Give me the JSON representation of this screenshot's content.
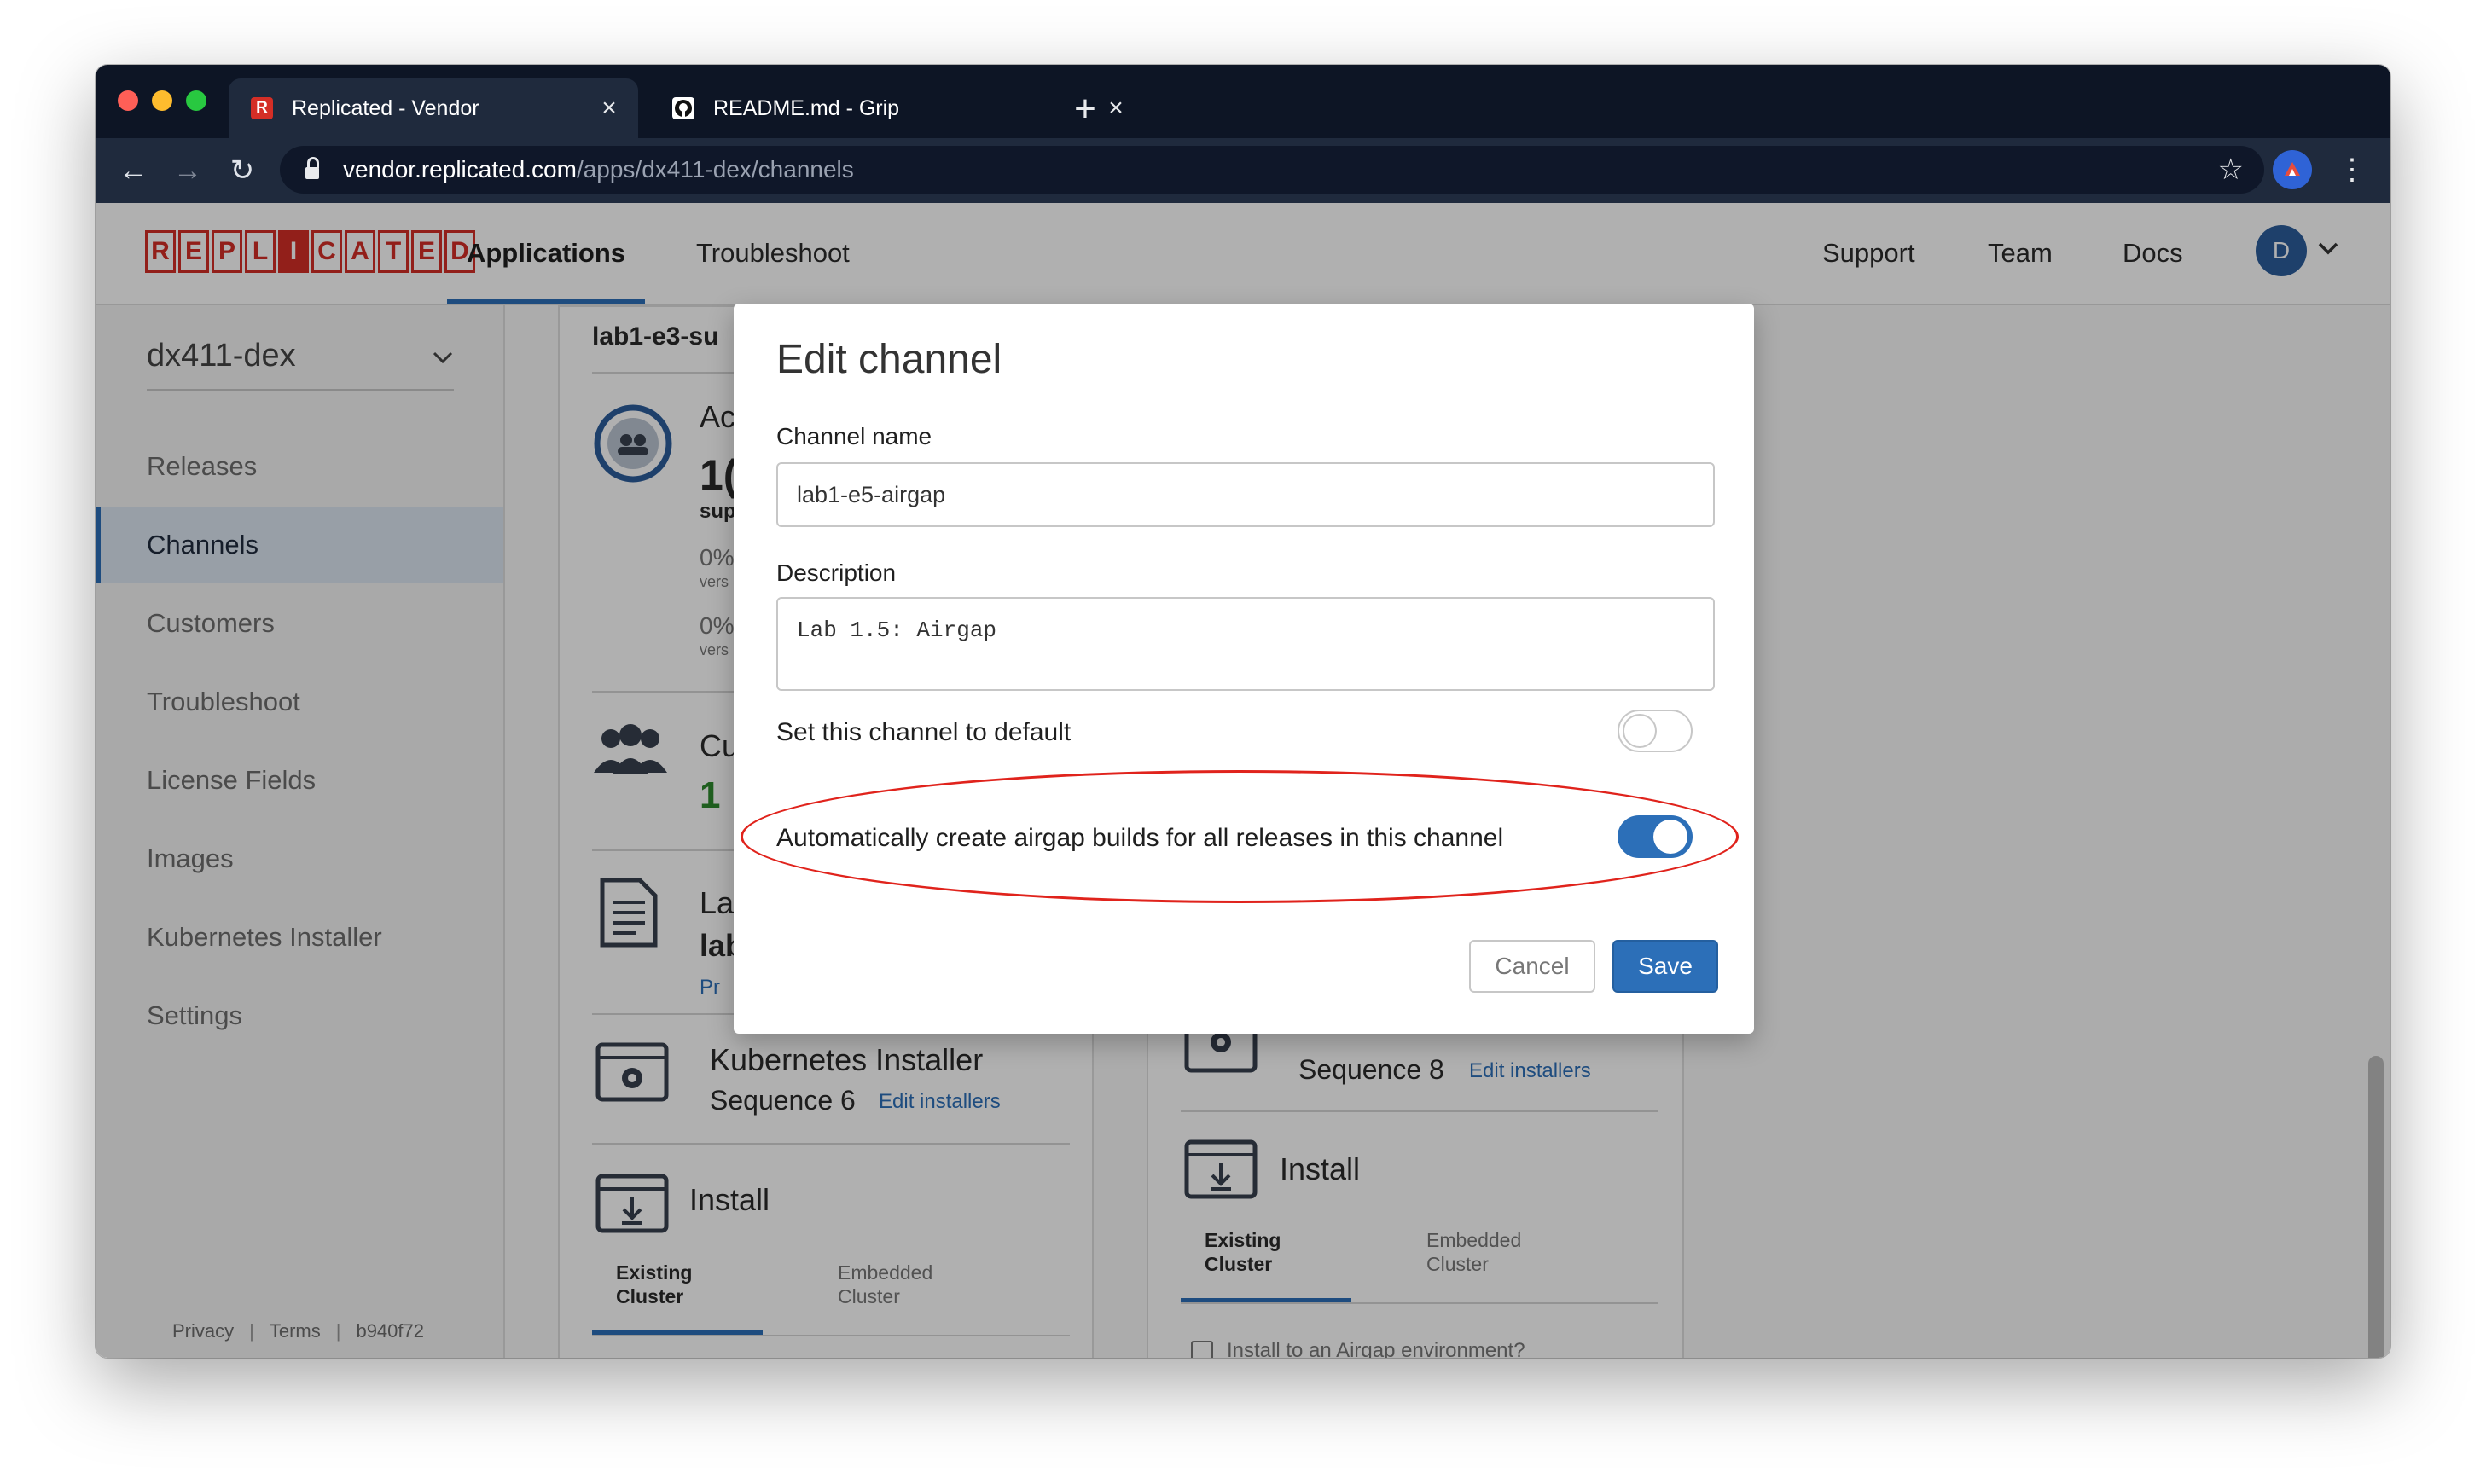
{
  "browser": {
    "tabs": [
      {
        "title": "Replicated - Vendor",
        "favicon": "replicated-r-icon",
        "active": true
      },
      {
        "title": "README.md - Grip",
        "favicon": "github-icon",
        "active": false
      }
    ],
    "url_host": "vendor.replicated.com",
    "url_path": "/apps/dx411-dex/channels",
    "profile_initial": ""
  },
  "header": {
    "logo_letters": [
      "R",
      "E",
      "P",
      "L",
      "I",
      "C",
      "A",
      "T",
      "E",
      "D"
    ],
    "nav": [
      "Applications",
      "Troubleshoot"
    ],
    "right_nav": [
      "Support",
      "Team",
      "Docs"
    ],
    "avatar_initial": "D"
  },
  "sidebar": {
    "app_name": "dx411-dex",
    "items": [
      "Releases",
      "Channels",
      "Customers",
      "Troubleshoot",
      "License Fields",
      "Images",
      "Kubernetes Installer",
      "Settings"
    ],
    "footer": {
      "privacy": "Privacy",
      "terms": "Terms",
      "build": "b940f72"
    }
  },
  "background": {
    "card1": {
      "title_fragment": "lab1-e3-su",
      "ac_fragment": "Ac",
      "num_fragment": "1(",
      "sup_fragment": "sup",
      "pct1": "0%",
      "vers1": "vers",
      "pct2": "0%",
      "vers2": "vers",
      "cu_fragment": "Cu",
      "cu_count": "1",
      "la_fragment": "La",
      "lab_fragment": "lab",
      "pr_fragment": "Pr",
      "k8s_title": "Kubernetes Installer",
      "sequence": "Sequence 6",
      "edit_installers": "Edit installers",
      "install": "Install",
      "tab_existing": "Existing Cluster",
      "tab_embedded": "Embedded Cluster"
    },
    "card2": {
      "sequence": "Sequence 8",
      "edit_installers": "Edit installers",
      "install": "Install",
      "tab_existing": "Existing Cluster",
      "tab_embedded": "Embedded Cluster",
      "airgap_checkbox": "Install to an Airgap environment?"
    }
  },
  "modal": {
    "title": "Edit channel",
    "channel_name_label": "Channel name",
    "channel_name_value": "lab1-e5-airgap",
    "description_label": "Description",
    "description_value": "Lab 1.5: Airgap",
    "default_toggle_label": "Set this channel to default",
    "default_toggle_on": false,
    "airgap_toggle_label": "Automatically create airgap builds for all releases in this channel",
    "airgap_toggle_on": true,
    "cancel_label": "Cancel",
    "save_label": "Save"
  },
  "colors": {
    "accent": "#2c6fb8",
    "brand_red": "#d42e26",
    "annotation_red": "#e0231c",
    "chrome_dark": "#0d1525"
  }
}
